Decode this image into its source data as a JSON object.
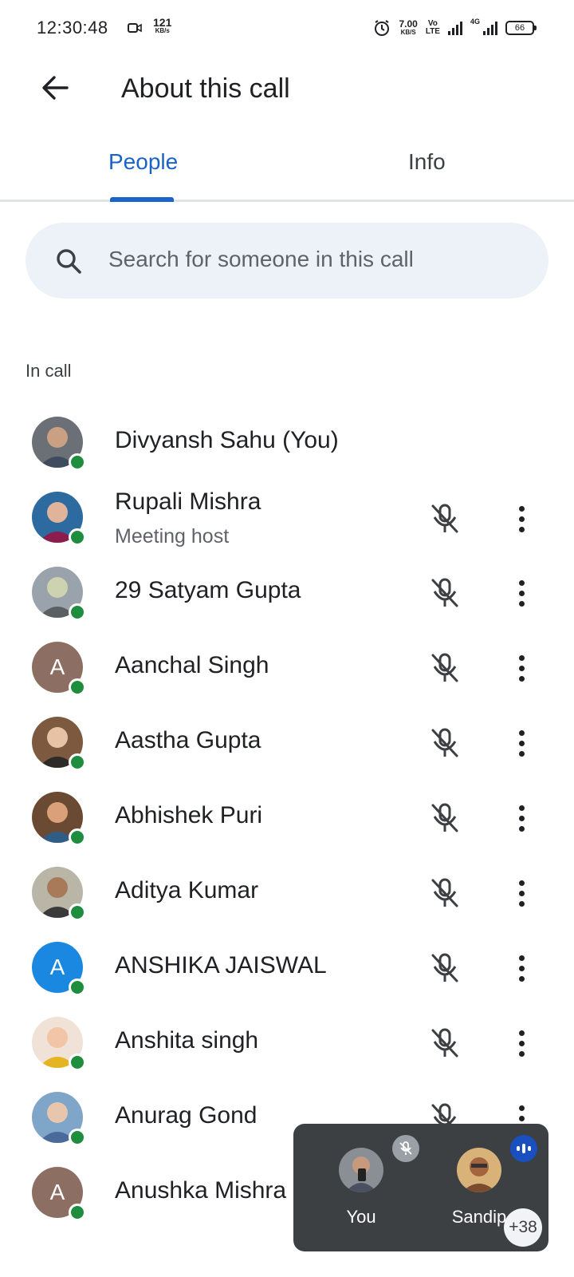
{
  "status_bar": {
    "time": "12:30:48",
    "speed_value": "121",
    "speed_unit": "KB/s",
    "net_value": "7.00",
    "net_unit": "KB/S",
    "volte_top": "Vo",
    "volte_bottom": "LTE",
    "network_type": "4G",
    "battery": "66"
  },
  "app_bar": {
    "title": "About this call"
  },
  "tabs": [
    {
      "label": "People",
      "selected": true
    },
    {
      "label": "Info",
      "selected": false
    }
  ],
  "search": {
    "placeholder": "Search for someone in this call"
  },
  "section_label": "In call",
  "participants": [
    {
      "name": "Divyansh Sahu (You)",
      "subtitle": "",
      "avatar": "photo",
      "show_controls": false
    },
    {
      "name": "Rupali Mishra",
      "subtitle": "Meeting host",
      "avatar": "photo",
      "show_controls": true
    },
    {
      "name": "29 Satyam Gupta",
      "subtitle": "",
      "avatar": "photo",
      "show_controls": true
    },
    {
      "name": "Aanchal Singh",
      "subtitle": "",
      "avatar_letter": "A",
      "avatar_color": "#8d6e63",
      "show_controls": true
    },
    {
      "name": "Aastha Gupta",
      "subtitle": "",
      "avatar": "photo",
      "show_controls": true
    },
    {
      "name": "Abhishek Puri",
      "subtitle": "",
      "avatar": "photo",
      "show_controls": true
    },
    {
      "name": "Aditya Kumar",
      "subtitle": "",
      "avatar": "photo",
      "show_controls": true
    },
    {
      "name": "ANSHIKA JAISWAL",
      "subtitle": "",
      "avatar_letter": "A",
      "avatar_color": "#1a88e0",
      "show_controls": true
    },
    {
      "name": "Anshita singh",
      "subtitle": "",
      "avatar": "photo",
      "show_controls": true
    },
    {
      "name": "Anurag Gond",
      "subtitle": "",
      "avatar": "photo",
      "show_controls": true
    },
    {
      "name": "Anushka Mishra",
      "subtitle": "",
      "avatar_letter": "A",
      "avatar_color": "#8d6e63",
      "show_controls": true
    }
  ],
  "pip": {
    "tile_you_label": "You",
    "tile_other_label": "Sandip",
    "overflow_count": "+38"
  },
  "colors": {
    "accent": "#1a63c7",
    "online": "#1e8e3e",
    "search_bg": "#edf2f9",
    "pip_bg": "#3c4043"
  }
}
